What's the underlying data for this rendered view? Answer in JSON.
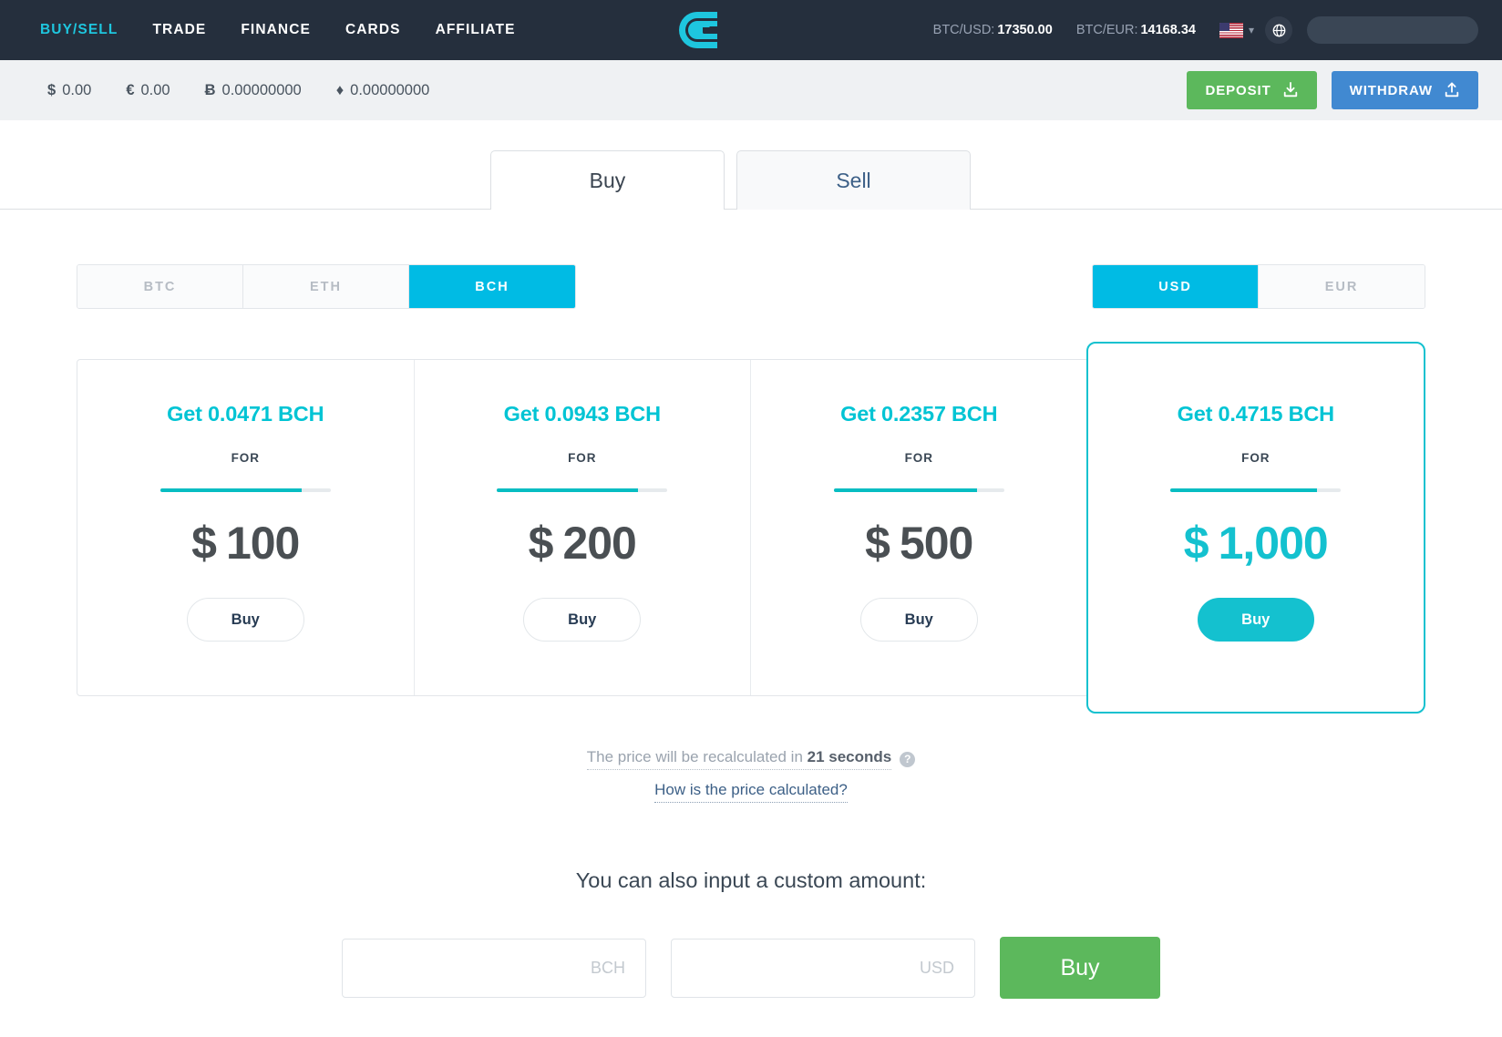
{
  "header": {
    "nav": [
      {
        "label": "BUY/SELL",
        "active": true
      },
      {
        "label": "TRADE",
        "active": false
      },
      {
        "label": "FINANCE",
        "active": false
      },
      {
        "label": "CARDS",
        "active": false
      },
      {
        "label": "AFFILIATE",
        "active": false
      }
    ],
    "logo_alt": "CEX.IO",
    "tickers": [
      {
        "label": "BTC/USD:",
        "value": "17350.00"
      },
      {
        "label": "BTC/EUR:",
        "value": "14168.34"
      }
    ],
    "language_flag": "us-flag-icon",
    "globe_icon": "globe-icon",
    "search_value": ""
  },
  "balances": [
    {
      "symbol": "$",
      "amount": "0.00"
    },
    {
      "symbol": "€",
      "amount": "0.00"
    },
    {
      "symbol": "Ƀ",
      "amount": "0.00000000"
    },
    {
      "symbol": "♦",
      "amount": "0.00000000"
    }
  ],
  "actions": {
    "deposit_label": "DEPOSIT",
    "withdraw_label": "WITHDRAW",
    "deposit_color": "#5cb85c",
    "withdraw_color": "#4189d1"
  },
  "tabs": [
    {
      "label": "Buy",
      "active": true
    },
    {
      "label": "Sell",
      "active": false
    }
  ],
  "crypto_segment": [
    {
      "label": "BTC",
      "active": false
    },
    {
      "label": "ETH",
      "active": false
    },
    {
      "label": "BCH",
      "active": true
    }
  ],
  "fiat_segment": [
    {
      "label": "USD",
      "active": true
    },
    {
      "label": "EUR",
      "active": false
    }
  ],
  "accent_color": "#00bbe4",
  "cards": [
    {
      "title": "Get 0.0471 BCH",
      "for_label": "FOR",
      "currency": "$",
      "amount": "100",
      "progress": 83,
      "buy_label": "Buy",
      "selected": false
    },
    {
      "title": "Get 0.0943 BCH",
      "for_label": "FOR",
      "currency": "$",
      "amount": "200",
      "progress": 83,
      "buy_label": "Buy",
      "selected": false
    },
    {
      "title": "Get 0.2357 BCH",
      "for_label": "FOR",
      "currency": "$",
      "amount": "500",
      "progress": 84,
      "buy_label": "Buy",
      "selected": false
    },
    {
      "title": "Get 0.4715 BCH",
      "for_label": "FOR",
      "currency": "$",
      "amount": "1,000",
      "progress": 86,
      "buy_label": "Buy",
      "selected": true
    }
  ],
  "recalc": {
    "prefix": "The price will be recalculated in ",
    "seconds": "21 seconds",
    "help_glyph": "?",
    "link_label": "How is the price calculated?"
  },
  "custom": {
    "title": "You can also input a custom amount:",
    "crypto_value": "",
    "crypto_placeholder": "BCH",
    "fiat_value": "",
    "fiat_placeholder": "USD",
    "buy_label": "Buy"
  }
}
